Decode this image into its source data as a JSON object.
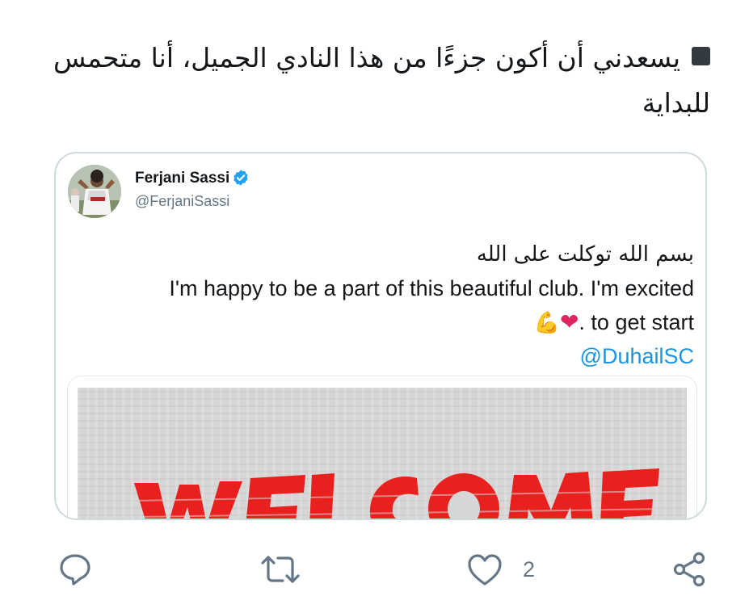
{
  "tweet": {
    "text": "يسعدني أن أكون جزءًا من هذا النادي الجميل، أنا متحمس للبداية"
  },
  "quoted_tweet": {
    "author_name": "Ferjani Sassi",
    "author_handle": "@FerjaniSassi",
    "verified": true,
    "line_arabic": "بسم الله توكلت على الله",
    "line_en_1": "I'm happy to be a part of this beautiful club. I'm excited",
    "line_en_2": ". to get start",
    "mention": "@DuhailSC",
    "media_text": "WELCOME"
  },
  "actions": {
    "reply_icon": "reply-icon",
    "retweet_icon": "retweet-icon",
    "like_icon": "heart-icon",
    "like_count": "2",
    "share_icon": "share-icon"
  },
  "colors": {
    "text": "#14171a",
    "secondary": "#657786",
    "link": "#1b95e0",
    "verified": "#1da1f2",
    "card_border": "#cfd9de",
    "media_red": "#e8201e"
  }
}
